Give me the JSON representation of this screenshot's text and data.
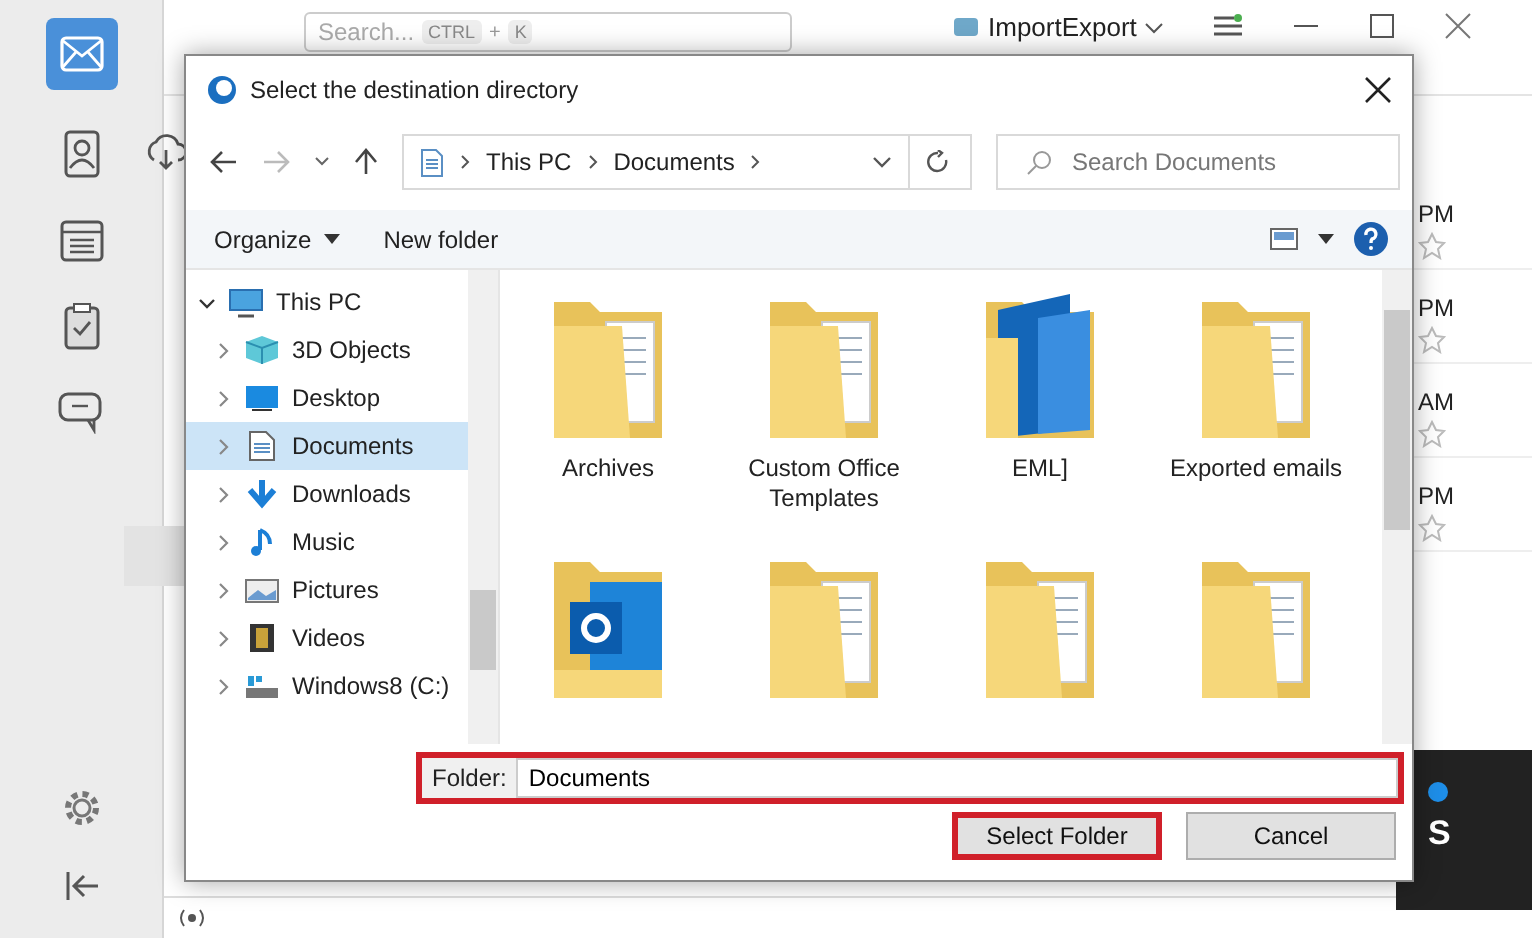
{
  "app": {
    "search": {
      "placeholder": "Search...",
      "keys": [
        "CTRL",
        "+",
        "K"
      ]
    },
    "account": "ImportExport",
    "times": [
      "PM",
      "PM",
      "AM",
      "PM"
    ],
    "side_panel": {
      "text": "S"
    }
  },
  "dialog": {
    "title": "Select the destination directory",
    "breadcrumb": [
      "This PC",
      "Documents"
    ],
    "search": {
      "placeholder": "Search Documents"
    },
    "toolbar": [
      {
        "label": "Organize",
        "kind": "menu"
      },
      {
        "label": "New folder",
        "kind": "plain"
      }
    ],
    "tree": [
      {
        "label": "This PC",
        "kind": "pc",
        "expanded": true,
        "selected": false,
        "children": [
          {
            "label": "3D Objects",
            "kind": "cube",
            "selected": false
          },
          {
            "label": "Desktop",
            "kind": "desktop",
            "selected": false
          },
          {
            "label": "Documents",
            "kind": "document",
            "selected": true
          },
          {
            "label": "Downloads",
            "kind": "download",
            "selected": false
          },
          {
            "label": "Music",
            "kind": "music",
            "selected": false
          },
          {
            "label": "Pictures",
            "kind": "pictures",
            "selected": false
          },
          {
            "label": "Videos",
            "kind": "videos",
            "selected": false
          },
          {
            "label": "Windows8 (C:)",
            "kind": "drive",
            "selected": false
          }
        ]
      }
    ],
    "items": [
      {
        "label": "Archives",
        "kind": "folder"
      },
      {
        "label": "Custom Office Templates",
        "kind": "folder"
      },
      {
        "label": "EML]",
        "kind": "blue"
      },
      {
        "label": "Exported emails",
        "kind": "folder"
      },
      {
        "kind": "outlook"
      },
      {
        "kind": "folder"
      },
      {
        "kind": "folder"
      },
      {
        "kind": "folder"
      }
    ],
    "folder_field": {
      "label": "Folder:",
      "value": "Documents",
      "highlighted": true
    },
    "buttons": [
      {
        "label": "Select Folder",
        "highlighted": true
      },
      {
        "label": "Cancel",
        "highlighted": false
      }
    ]
  }
}
